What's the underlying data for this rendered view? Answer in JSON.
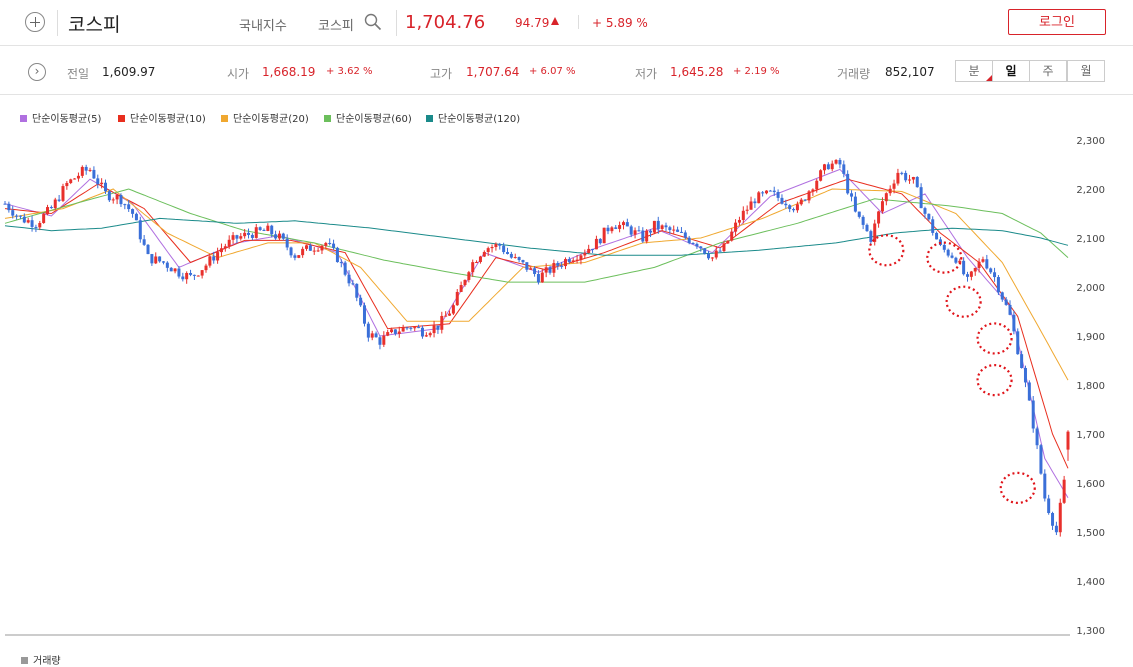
{
  "header": {
    "title": "코스피",
    "market_label": "국내지수",
    "index_label": "코스피",
    "price": "1,704.76",
    "change": "94.79",
    "change_pct": "+ 5.89 %",
    "login_label": "로그인"
  },
  "stats": {
    "prev_label": "전일",
    "prev_value": "1,609.97",
    "open_label": "시가",
    "open_value": "1,668.19",
    "open_pct": "+ 3.62 %",
    "high_label": "고가",
    "high_value": "1,707.64",
    "high_pct": "+ 6.07 %",
    "low_label": "저가",
    "low_value": "1,645.28",
    "low_pct": "+ 2.19 %",
    "volume_label": "거래량",
    "volume_value": "852,107"
  },
  "periods": [
    "분",
    "일",
    "주",
    "월"
  ],
  "active_period": "일",
  "colors": {
    "up": "#e8302c",
    "down": "#3a6fd8",
    "ma5": "#b070e0",
    "ma10": "#e82e1e",
    "ma20": "#f0a830",
    "ma60": "#6cbf5c",
    "ma120": "#1a8a8a",
    "marker": "#e0141a"
  },
  "volume_legend": "거래량",
  "chart_data": {
    "type": "candlestick",
    "title": "",
    "ylim": [
      1300,
      2320
    ],
    "y_ticks": [
      "2,300",
      "2,200",
      "2,100",
      "2,000",
      "1,900",
      "1,800",
      "1,700",
      "1,600",
      "1,500",
      "1,400",
      "1,300"
    ],
    "grid": false,
    "legend_position": "top-left",
    "legend": [
      "단순이동평균(5)",
      "단순이동평균(10)",
      "단순이동평균(20)",
      "단순이동평균(60)",
      "단순이동평균(120)"
    ],
    "close_path": [
      [
        0,
        2170
      ],
      [
        4,
        2140
      ],
      [
        8,
        2130
      ],
      [
        12,
        2160
      ],
      [
        16,
        2210
      ],
      [
        20,
        2235
      ],
      [
        22,
        2240
      ],
      [
        26,
        2190
      ],
      [
        30,
        2180
      ],
      [
        33,
        2150
      ],
      [
        37,
        2060
      ],
      [
        41,
        2050
      ],
      [
        45,
        2030
      ],
      [
        48,
        2020
      ],
      [
        52,
        2045
      ],
      [
        56,
        2080
      ],
      [
        60,
        2100
      ],
      [
        64,
        2110
      ],
      [
        68,
        2115
      ],
      [
        71,
        2100
      ],
      [
        75,
        2065
      ],
      [
        79,
        2080
      ],
      [
        83,
        2090
      ],
      [
        86,
        2060
      ],
      [
        90,
        2000
      ],
      [
        94,
        1905
      ],
      [
        97,
        1890
      ],
      [
        101,
        1910
      ],
      [
        105,
        1920
      ],
      [
        108,
        1910
      ],
      [
        112,
        1920
      ],
      [
        116,
        1960
      ],
      [
        120,
        2040
      ],
      [
        124,
        2080
      ],
      [
        128,
        2085
      ],
      [
        131,
        2060
      ],
      [
        135,
        2040
      ],
      [
        138,
        2020
      ],
      [
        142,
        2040
      ],
      [
        146,
        2060
      ],
      [
        149,
        2070
      ],
      [
        153,
        2090
      ],
      [
        157,
        2130
      ],
      [
        161,
        2120
      ],
      [
        165,
        2100
      ],
      [
        168,
        2125
      ],
      [
        172,
        2115
      ],
      [
        175,
        2105
      ],
      [
        179,
        2090
      ],
      [
        183,
        2060
      ],
      [
        186,
        2080
      ],
      [
        190,
        2140
      ],
      [
        194,
        2180
      ],
      [
        198,
        2190
      ],
      [
        202,
        2175
      ],
      [
        205,
        2160
      ],
      [
        209,
        2210
      ],
      [
        213,
        2250
      ],
      [
        216,
        2250
      ],
      [
        220,
        2150
      ],
      [
        224,
        2100
      ],
      [
        227,
        2175
      ],
      [
        231,
        2235
      ],
      [
        235,
        2215
      ],
      [
        238,
        2150
      ],
      [
        242,
        2080
      ],
      [
        246,
        2060
      ],
      [
        249,
        2010
      ],
      [
        253,
        2060
      ],
      [
        256,
        2020
      ],
      [
        260,
        1940
      ],
      [
        263,
        1840
      ],
      [
        266,
        1720
      ],
      [
        269,
        1570
      ],
      [
        272,
        1500
      ],
      [
        274,
        1600
      ],
      [
        275,
        1704
      ]
    ],
    "ma_paths": {
      "ma5": [
        [
          0,
          2170
        ],
        [
          12,
          2145
        ],
        [
          22,
          2220
        ],
        [
          33,
          2170
        ],
        [
          45,
          2040
        ],
        [
          60,
          2090
        ],
        [
          71,
          2105
        ],
        [
          86,
          2070
        ],
        [
          97,
          1900
        ],
        [
          112,
          1915
        ],
        [
          124,
          2070
        ],
        [
          138,
          2030
        ],
        [
          153,
          2080
        ],
        [
          168,
          2120
        ],
        [
          183,
          2070
        ],
        [
          198,
          2185
        ],
        [
          216,
          2240
        ],
        [
          227,
          2150
        ],
        [
          238,
          2190
        ],
        [
          249,
          2060
        ],
        [
          260,
          1960
        ],
        [
          269,
          1650
        ],
        [
          275,
          1570
        ]
      ],
      "ma10": [
        [
          0,
          2160
        ],
        [
          12,
          2150
        ],
        [
          24,
          2210
        ],
        [
          36,
          2160
        ],
        [
          48,
          2050
        ],
        [
          62,
          2095
        ],
        [
          74,
          2095
        ],
        [
          88,
          2070
        ],
        [
          99,
          1915
        ],
        [
          115,
          1925
        ],
        [
          127,
          2060
        ],
        [
          140,
          2035
        ],
        [
          155,
          2070
        ],
        [
          170,
          2115
        ],
        [
          185,
          2080
        ],
        [
          200,
          2170
        ],
        [
          218,
          2220
        ],
        [
          232,
          2190
        ],
        [
          242,
          2110
        ],
        [
          252,
          2050
        ],
        [
          262,
          1940
        ],
        [
          271,
          1700
        ],
        [
          275,
          1630
        ]
      ],
      "ma20": [
        [
          0,
          2140
        ],
        [
          15,
          2160
        ],
        [
          28,
          2200
        ],
        [
          42,
          2110
        ],
        [
          55,
          2060
        ],
        [
          68,
          2090
        ],
        [
          80,
          2090
        ],
        [
          92,
          2040
        ],
        [
          104,
          1930
        ],
        [
          120,
          1930
        ],
        [
          134,
          2040
        ],
        [
          150,
          2050
        ],
        [
          165,
          2090
        ],
        [
          180,
          2100
        ],
        [
          196,
          2140
        ],
        [
          214,
          2200
        ],
        [
          232,
          2195
        ],
        [
          246,
          2150
        ],
        [
          258,
          2050
        ],
        [
          268,
          1910
        ],
        [
          275,
          1810
        ]
      ],
      "ma60": [
        [
          0,
          2130
        ],
        [
          18,
          2170
        ],
        [
          32,
          2200
        ],
        [
          48,
          2150
        ],
        [
          62,
          2115
        ],
        [
          80,
          2090
        ],
        [
          98,
          2055
        ],
        [
          115,
          2030
        ],
        [
          130,
          2010
        ],
        [
          150,
          2010
        ],
        [
          168,
          2040
        ],
        [
          185,
          2090
        ],
        [
          205,
          2130
        ],
        [
          225,
          2180
        ],
        [
          245,
          2165
        ],
        [
          258,
          2150
        ],
        [
          268,
          2110
        ],
        [
          275,
          2060
        ]
      ],
      "ma120": [
        [
          0,
          2125
        ],
        [
          12,
          2115
        ],
        [
          25,
          2120
        ],
        [
          40,
          2140
        ],
        [
          60,
          2130
        ],
        [
          75,
          2135
        ],
        [
          95,
          2120
        ],
        [
          115,
          2100
        ],
        [
          135,
          2080
        ],
        [
          155,
          2065
        ],
        [
          175,
          2065
        ],
        [
          195,
          2075
        ],
        [
          215,
          2090
        ],
        [
          230,
          2110
        ],
        [
          245,
          2120
        ],
        [
          258,
          2115
        ],
        [
          268,
          2100
        ],
        [
          275,
          2085
        ]
      ]
    },
    "annotations": [
      {
        "x": 228,
        "y": 2075,
        "shape": "dotted-ellipse"
      },
      {
        "x": 243,
        "y": 2060,
        "shape": "dotted-ellipse"
      },
      {
        "x": 248,
        "y": 1970,
        "shape": "dotted-ellipse"
      },
      {
        "x": 256,
        "y": 1895,
        "shape": "dotted-ellipse"
      },
      {
        "x": 256,
        "y": 1810,
        "shape": "dotted-ellipse"
      },
      {
        "x": 262,
        "y": 1590,
        "shape": "dotted-ellipse"
      }
    ]
  }
}
